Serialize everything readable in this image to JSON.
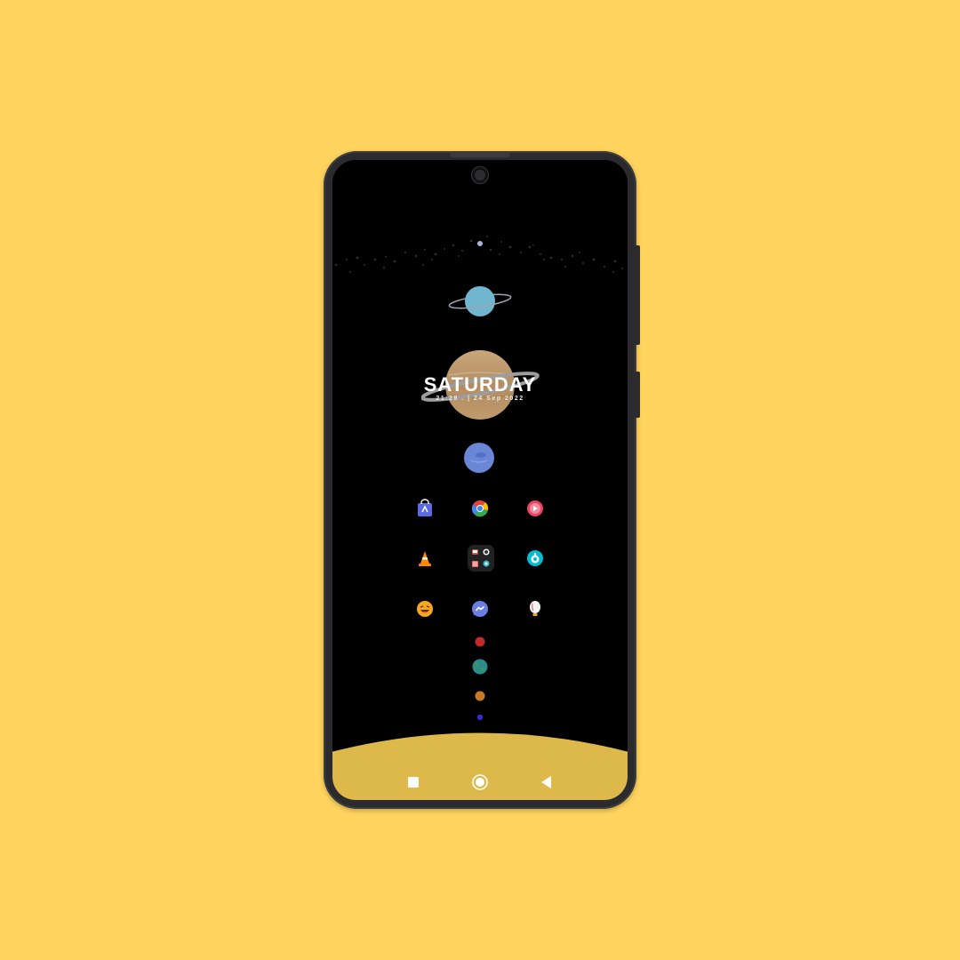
{
  "widget": {
    "day": "SATURDAY",
    "datetime": "21:29 . | 24 Sep 2022"
  },
  "apps": [
    {
      "name": "store-app-icon",
      "color": "#5B6BE0"
    },
    {
      "name": "chrome-app-icon",
      "color": "#4CAF50"
    },
    {
      "name": "music-player-app-icon",
      "color": "#E94560"
    },
    {
      "name": "vlc-app-icon",
      "color": "#FF8800"
    },
    {
      "name": "folder-app-icon",
      "color": "#222222"
    },
    {
      "name": "timer-app-icon",
      "color": "#00BCD4"
    },
    {
      "name": "emoji-app-icon",
      "color": "#F6A623"
    },
    {
      "name": "messenger-app-icon",
      "color": "#6B7FE3"
    },
    {
      "name": "balloon-app-icon",
      "color": "#F3F3F3"
    }
  ],
  "colors": {
    "background": "#FFD45E",
    "dock": "#DDB84A",
    "uranus": "#6FB6CE",
    "saturn": "#B8956A",
    "neptune": "#6A86D6",
    "mars": "#C02A2A",
    "earth": "#2F8B8B",
    "venus": "#C77A26",
    "mercury": "#3A2BC8"
  },
  "nav": {
    "recents": "square-icon",
    "home": "circle-icon",
    "back": "triangle-icon"
  }
}
